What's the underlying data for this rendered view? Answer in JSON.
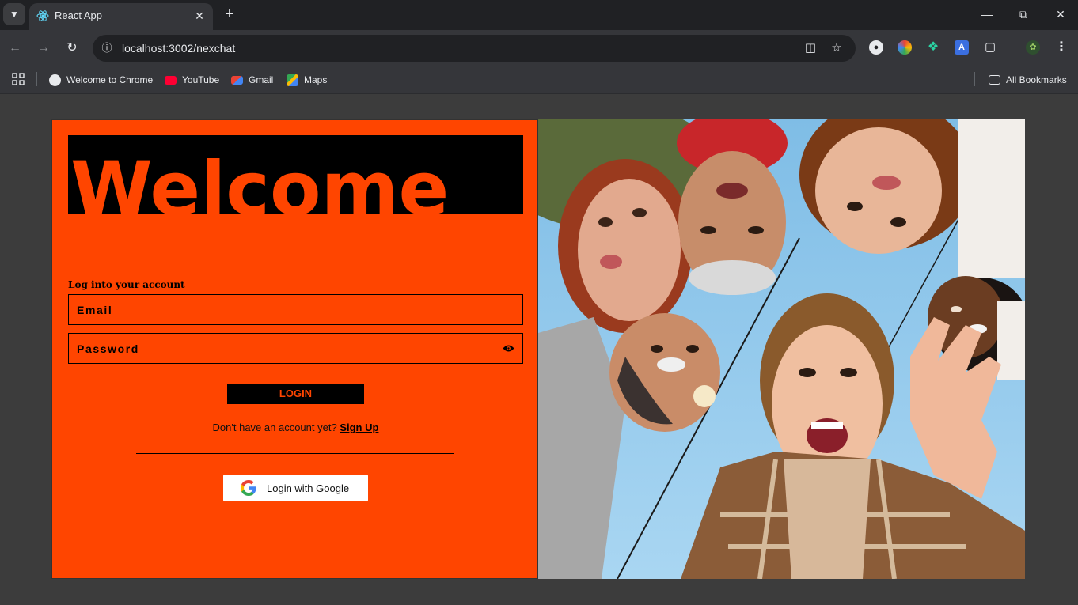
{
  "browser": {
    "tab": {
      "title": "React App"
    },
    "address": {
      "url": "localhost:3002/nexchat"
    },
    "bookmarks": [
      {
        "label": "Welcome to Chrome"
      },
      {
        "label": "YouTube"
      },
      {
        "label": "Gmail"
      },
      {
        "label": "Maps"
      }
    ],
    "all_bookmarks": "All Bookmarks"
  },
  "login": {
    "heading": "Welcome",
    "subheading": "Log into your account",
    "email_placeholder": "Email",
    "password_placeholder": "Password",
    "login_button": "LOGIN",
    "signup_prompt": "Don't have an account yet?",
    "signup_link": "Sign Up",
    "google_button": "Login with Google"
  },
  "theme": {
    "accent": "#ff4500",
    "dark": "#000000",
    "page_bg": "#3c3c3c"
  }
}
